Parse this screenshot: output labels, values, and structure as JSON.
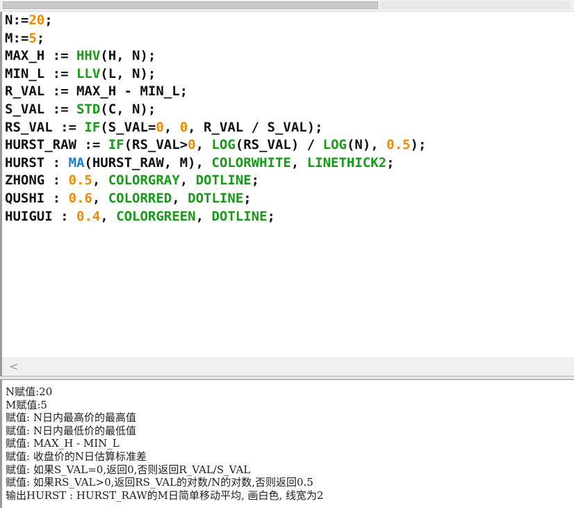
{
  "editor": {
    "lines": [
      [
        {
          "t": "N:=",
          "c": "plain"
        },
        {
          "t": "20",
          "c": "num"
        },
        {
          "t": ";",
          "c": "plain"
        }
      ],
      [
        {
          "t": "M:=",
          "c": "plain"
        },
        {
          "t": "5",
          "c": "num"
        },
        {
          "t": ";",
          "c": "plain"
        }
      ],
      [
        {
          "t": "MAX_H := ",
          "c": "plain"
        },
        {
          "t": "HHV",
          "c": "fn"
        },
        {
          "t": "(H, N);",
          "c": "plain"
        }
      ],
      [
        {
          "t": "MIN_L := ",
          "c": "plain"
        },
        {
          "t": "LLV",
          "c": "fn"
        },
        {
          "t": "(L, N);",
          "c": "plain"
        }
      ],
      [
        {
          "t": "R_VAL := MAX_H - MIN_L;",
          "c": "plain"
        }
      ],
      [
        {
          "t": "S_VAL := ",
          "c": "plain"
        },
        {
          "t": "STD",
          "c": "fn"
        },
        {
          "t": "(C, N);",
          "c": "plain"
        }
      ],
      [
        {
          "t": "RS_VAL := ",
          "c": "plain"
        },
        {
          "t": "IF",
          "c": "fn"
        },
        {
          "t": "(S_VAL=",
          "c": "plain"
        },
        {
          "t": "0",
          "c": "num"
        },
        {
          "t": ", ",
          "c": "plain"
        },
        {
          "t": "0",
          "c": "num"
        },
        {
          "t": ", R_VAL / S_VAL);",
          "c": "plain"
        }
      ],
      [
        {
          "t": "HURST_RAW := ",
          "c": "plain"
        },
        {
          "t": "IF",
          "c": "fn"
        },
        {
          "t": "(RS_VAL>",
          "c": "plain"
        },
        {
          "t": "0",
          "c": "num"
        },
        {
          "t": ", ",
          "c": "plain"
        },
        {
          "t": "LOG",
          "c": "fn"
        },
        {
          "t": "(RS_VAL) / ",
          "c": "plain"
        },
        {
          "t": "LOG",
          "c": "fn"
        },
        {
          "t": "(N), ",
          "c": "plain"
        },
        {
          "t": "0.5",
          "c": "num"
        },
        {
          "t": ");",
          "c": "plain"
        }
      ],
      [
        {
          "t": "HURST : ",
          "c": "plain"
        },
        {
          "t": "MA",
          "c": "ma"
        },
        {
          "t": "(HURST_RAW, M), ",
          "c": "plain"
        },
        {
          "t": "COLORWHITE",
          "c": "kw"
        },
        {
          "t": ", ",
          "c": "plain"
        },
        {
          "t": "LINETHICK2",
          "c": "kw"
        },
        {
          "t": ";",
          "c": "plain"
        }
      ],
      [
        {
          "t": "ZHONG : ",
          "c": "plain"
        },
        {
          "t": "0.5",
          "c": "num"
        },
        {
          "t": ", ",
          "c": "plain"
        },
        {
          "t": "COLORGRAY",
          "c": "kw"
        },
        {
          "t": ", ",
          "c": "plain"
        },
        {
          "t": "DOTLINE",
          "c": "kw"
        },
        {
          "t": ";",
          "c": "plain"
        }
      ],
      [
        {
          "t": "QUSHI : ",
          "c": "plain"
        },
        {
          "t": "0.6",
          "c": "num"
        },
        {
          "t": ", ",
          "c": "plain"
        },
        {
          "t": "COLORRED",
          "c": "kw"
        },
        {
          "t": ", ",
          "c": "plain"
        },
        {
          "t": "DOTLINE",
          "c": "kw"
        },
        {
          "t": ";",
          "c": "plain"
        }
      ],
      [
        {
          "t": "HUIGUI : ",
          "c": "plain"
        },
        {
          "t": "0.4",
          "c": "num"
        },
        {
          "t": ", ",
          "c": "plain"
        },
        {
          "t": "COLORGREEN",
          "c": "kw"
        },
        {
          "t": ", ",
          "c": "plain"
        },
        {
          "t": "DOTLINE",
          "c": "kw"
        },
        {
          "t": ";",
          "c": "plain"
        }
      ]
    ]
  },
  "scrollbar": {
    "left_arrow": "<"
  },
  "description": {
    "lines": [
      "N赋值:20",
      "M赋值:5",
      "赋值: N日内最高价的最高值",
      "赋值: N日内最低价的最低值",
      "赋值: MAX_H - MIN_L",
      "赋值: 收盘价的N日估算标准差",
      "赋值: 如果S_VAL=0,返回0,否则返回R_VAL/S_VAL",
      "赋值: 如果RS_VAL>0,返回RS_VAL的对数/N的对数,否则返回0.5",
      "输出HURST : HURST_RAW的M日简单移动平均, 画白色, 线宽为2"
    ]
  },
  "colors": {
    "number": "#f08a00",
    "function": "#169b16",
    "ma_function": "#1a7fd6",
    "text": "#111111"
  }
}
